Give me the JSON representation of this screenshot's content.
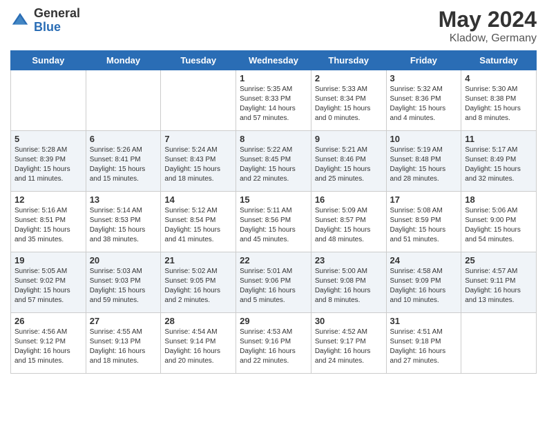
{
  "header": {
    "logo_general": "General",
    "logo_blue": "Blue",
    "month_year": "May 2024",
    "location": "Kladow, Germany"
  },
  "days_of_week": [
    "Sunday",
    "Monday",
    "Tuesday",
    "Wednesday",
    "Thursday",
    "Friday",
    "Saturday"
  ],
  "weeks": [
    [
      {
        "date": "",
        "sunrise": "",
        "sunset": "",
        "daylight": ""
      },
      {
        "date": "",
        "sunrise": "",
        "sunset": "",
        "daylight": ""
      },
      {
        "date": "",
        "sunrise": "",
        "sunset": "",
        "daylight": ""
      },
      {
        "date": "1",
        "sunrise": "Sunrise: 5:35 AM",
        "sunset": "Sunset: 8:33 PM",
        "daylight": "Daylight: 14 hours and 57 minutes."
      },
      {
        "date": "2",
        "sunrise": "Sunrise: 5:33 AM",
        "sunset": "Sunset: 8:34 PM",
        "daylight": "Daylight: 15 hours and 0 minutes."
      },
      {
        "date": "3",
        "sunrise": "Sunrise: 5:32 AM",
        "sunset": "Sunset: 8:36 PM",
        "daylight": "Daylight: 15 hours and 4 minutes."
      },
      {
        "date": "4",
        "sunrise": "Sunrise: 5:30 AM",
        "sunset": "Sunset: 8:38 PM",
        "daylight": "Daylight: 15 hours and 8 minutes."
      }
    ],
    [
      {
        "date": "5",
        "sunrise": "Sunrise: 5:28 AM",
        "sunset": "Sunset: 8:39 PM",
        "daylight": "Daylight: 15 hours and 11 minutes."
      },
      {
        "date": "6",
        "sunrise": "Sunrise: 5:26 AM",
        "sunset": "Sunset: 8:41 PM",
        "daylight": "Daylight: 15 hours and 15 minutes."
      },
      {
        "date": "7",
        "sunrise": "Sunrise: 5:24 AM",
        "sunset": "Sunset: 8:43 PM",
        "daylight": "Daylight: 15 hours and 18 minutes."
      },
      {
        "date": "8",
        "sunrise": "Sunrise: 5:22 AM",
        "sunset": "Sunset: 8:45 PM",
        "daylight": "Daylight: 15 hours and 22 minutes."
      },
      {
        "date": "9",
        "sunrise": "Sunrise: 5:21 AM",
        "sunset": "Sunset: 8:46 PM",
        "daylight": "Daylight: 15 hours and 25 minutes."
      },
      {
        "date": "10",
        "sunrise": "Sunrise: 5:19 AM",
        "sunset": "Sunset: 8:48 PM",
        "daylight": "Daylight: 15 hours and 28 minutes."
      },
      {
        "date": "11",
        "sunrise": "Sunrise: 5:17 AM",
        "sunset": "Sunset: 8:49 PM",
        "daylight": "Daylight: 15 hours and 32 minutes."
      }
    ],
    [
      {
        "date": "12",
        "sunrise": "Sunrise: 5:16 AM",
        "sunset": "Sunset: 8:51 PM",
        "daylight": "Daylight: 15 hours and 35 minutes."
      },
      {
        "date": "13",
        "sunrise": "Sunrise: 5:14 AM",
        "sunset": "Sunset: 8:53 PM",
        "daylight": "Daylight: 15 hours and 38 minutes."
      },
      {
        "date": "14",
        "sunrise": "Sunrise: 5:12 AM",
        "sunset": "Sunset: 8:54 PM",
        "daylight": "Daylight: 15 hours and 41 minutes."
      },
      {
        "date": "15",
        "sunrise": "Sunrise: 5:11 AM",
        "sunset": "Sunset: 8:56 PM",
        "daylight": "Daylight: 15 hours and 45 minutes."
      },
      {
        "date": "16",
        "sunrise": "Sunrise: 5:09 AM",
        "sunset": "Sunset: 8:57 PM",
        "daylight": "Daylight: 15 hours and 48 minutes."
      },
      {
        "date": "17",
        "sunrise": "Sunrise: 5:08 AM",
        "sunset": "Sunset: 8:59 PM",
        "daylight": "Daylight: 15 hours and 51 minutes."
      },
      {
        "date": "18",
        "sunrise": "Sunrise: 5:06 AM",
        "sunset": "Sunset: 9:00 PM",
        "daylight": "Daylight: 15 hours and 54 minutes."
      }
    ],
    [
      {
        "date": "19",
        "sunrise": "Sunrise: 5:05 AM",
        "sunset": "Sunset: 9:02 PM",
        "daylight": "Daylight: 15 hours and 57 minutes."
      },
      {
        "date": "20",
        "sunrise": "Sunrise: 5:03 AM",
        "sunset": "Sunset: 9:03 PM",
        "daylight": "Daylight: 15 hours and 59 minutes."
      },
      {
        "date": "21",
        "sunrise": "Sunrise: 5:02 AM",
        "sunset": "Sunset: 9:05 PM",
        "daylight": "Daylight: 16 hours and 2 minutes."
      },
      {
        "date": "22",
        "sunrise": "Sunrise: 5:01 AM",
        "sunset": "Sunset: 9:06 PM",
        "daylight": "Daylight: 16 hours and 5 minutes."
      },
      {
        "date": "23",
        "sunrise": "Sunrise: 5:00 AM",
        "sunset": "Sunset: 9:08 PM",
        "daylight": "Daylight: 16 hours and 8 minutes."
      },
      {
        "date": "24",
        "sunrise": "Sunrise: 4:58 AM",
        "sunset": "Sunset: 9:09 PM",
        "daylight": "Daylight: 16 hours and 10 minutes."
      },
      {
        "date": "25",
        "sunrise": "Sunrise: 4:57 AM",
        "sunset": "Sunset: 9:11 PM",
        "daylight": "Daylight: 16 hours and 13 minutes."
      }
    ],
    [
      {
        "date": "26",
        "sunrise": "Sunrise: 4:56 AM",
        "sunset": "Sunset: 9:12 PM",
        "daylight": "Daylight: 16 hours and 15 minutes."
      },
      {
        "date": "27",
        "sunrise": "Sunrise: 4:55 AM",
        "sunset": "Sunset: 9:13 PM",
        "daylight": "Daylight: 16 hours and 18 minutes."
      },
      {
        "date": "28",
        "sunrise": "Sunrise: 4:54 AM",
        "sunset": "Sunset: 9:14 PM",
        "daylight": "Daylight: 16 hours and 20 minutes."
      },
      {
        "date": "29",
        "sunrise": "Sunrise: 4:53 AM",
        "sunset": "Sunset: 9:16 PM",
        "daylight": "Daylight: 16 hours and 22 minutes."
      },
      {
        "date": "30",
        "sunrise": "Sunrise: 4:52 AM",
        "sunset": "Sunset: 9:17 PM",
        "daylight": "Daylight: 16 hours and 24 minutes."
      },
      {
        "date": "31",
        "sunrise": "Sunrise: 4:51 AM",
        "sunset": "Sunset: 9:18 PM",
        "daylight": "Daylight: 16 hours and 27 minutes."
      },
      {
        "date": "",
        "sunrise": "",
        "sunset": "",
        "daylight": ""
      }
    ]
  ]
}
